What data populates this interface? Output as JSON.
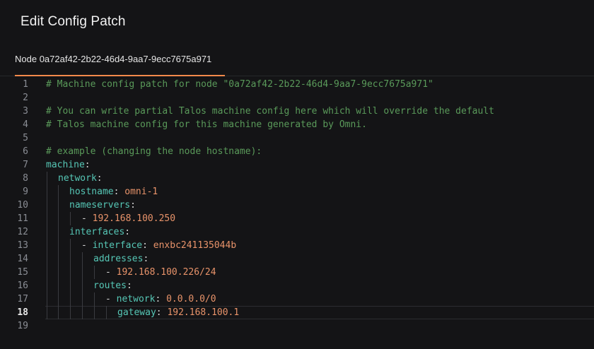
{
  "dialog": {
    "title": "Edit Config Patch"
  },
  "tabs": [
    {
      "label": "Node 0a72af42-2b22-46d4-9aa7-9ecc7675a971",
      "active": true
    }
  ],
  "colors": {
    "accent": "#f2894b",
    "comment": "#5a9a5a",
    "key": "#56c7b6",
    "value": "#e8936a"
  },
  "editor": {
    "active_line": 18,
    "lines": [
      {
        "n": "1",
        "indent": 0,
        "tokens": [
          {
            "t": "comment",
            "v": "# Machine config patch for node \"0a72af42-2b22-46d4-9aa7-9ecc7675a971\""
          }
        ]
      },
      {
        "n": "2",
        "indent": 0,
        "tokens": []
      },
      {
        "n": "3",
        "indent": 0,
        "tokens": [
          {
            "t": "comment",
            "v": "# You can write partial Talos machine config here which will override the default"
          }
        ]
      },
      {
        "n": "4",
        "indent": 0,
        "tokens": [
          {
            "t": "comment",
            "v": "# Talos machine config for this machine generated by Omni."
          }
        ]
      },
      {
        "n": "5",
        "indent": 0,
        "tokens": []
      },
      {
        "n": "6",
        "indent": 0,
        "tokens": [
          {
            "t": "comment",
            "v": "# example (changing the node hostname):"
          }
        ]
      },
      {
        "n": "7",
        "indent": 0,
        "tokens": [
          {
            "t": "key",
            "v": "machine"
          },
          {
            "t": "punct",
            "v": ":"
          }
        ]
      },
      {
        "n": "8",
        "indent": 1,
        "tokens": [
          {
            "t": "key",
            "v": "network"
          },
          {
            "t": "punct",
            "v": ":"
          }
        ]
      },
      {
        "n": "9",
        "indent": 2,
        "tokens": [
          {
            "t": "key",
            "v": "hostname"
          },
          {
            "t": "punct",
            "v": ": "
          },
          {
            "t": "val",
            "v": "omni-1"
          }
        ]
      },
      {
        "n": "10",
        "indent": 2,
        "tokens": [
          {
            "t": "key",
            "v": "nameservers"
          },
          {
            "t": "punct",
            "v": ":"
          }
        ]
      },
      {
        "n": "11",
        "indent": 3,
        "tokens": [
          {
            "t": "punct",
            "v": "- "
          },
          {
            "t": "val",
            "v": "192.168.100.250"
          }
        ]
      },
      {
        "n": "12",
        "indent": 2,
        "tokens": [
          {
            "t": "key",
            "v": "interfaces"
          },
          {
            "t": "punct",
            "v": ":"
          }
        ]
      },
      {
        "n": "13",
        "indent": 3,
        "tokens": [
          {
            "t": "punct",
            "v": "- "
          },
          {
            "t": "key",
            "v": "interface"
          },
          {
            "t": "punct",
            "v": ": "
          },
          {
            "t": "val",
            "v": "enxbc241135044b"
          }
        ]
      },
      {
        "n": "14",
        "indent": 4,
        "tokens": [
          {
            "t": "key",
            "v": "addresses"
          },
          {
            "t": "punct",
            "v": ":"
          }
        ]
      },
      {
        "n": "15",
        "indent": 5,
        "tokens": [
          {
            "t": "punct",
            "v": "- "
          },
          {
            "t": "val",
            "v": "192.168.100.226/24"
          }
        ]
      },
      {
        "n": "16",
        "indent": 4,
        "tokens": [
          {
            "t": "key",
            "v": "routes"
          },
          {
            "t": "punct",
            "v": ":"
          }
        ]
      },
      {
        "n": "17",
        "indent": 5,
        "tokens": [
          {
            "t": "punct",
            "v": "- "
          },
          {
            "t": "key",
            "v": "network"
          },
          {
            "t": "punct",
            "v": ": "
          },
          {
            "t": "val",
            "v": "0.0.0.0/0"
          }
        ]
      },
      {
        "n": "18",
        "indent": 6,
        "tokens": [
          {
            "t": "key",
            "v": "gateway"
          },
          {
            "t": "punct",
            "v": ": "
          },
          {
            "t": "val",
            "v": "192.168.100.1"
          }
        ]
      },
      {
        "n": "19",
        "indent": 0,
        "tokens": []
      }
    ]
  }
}
